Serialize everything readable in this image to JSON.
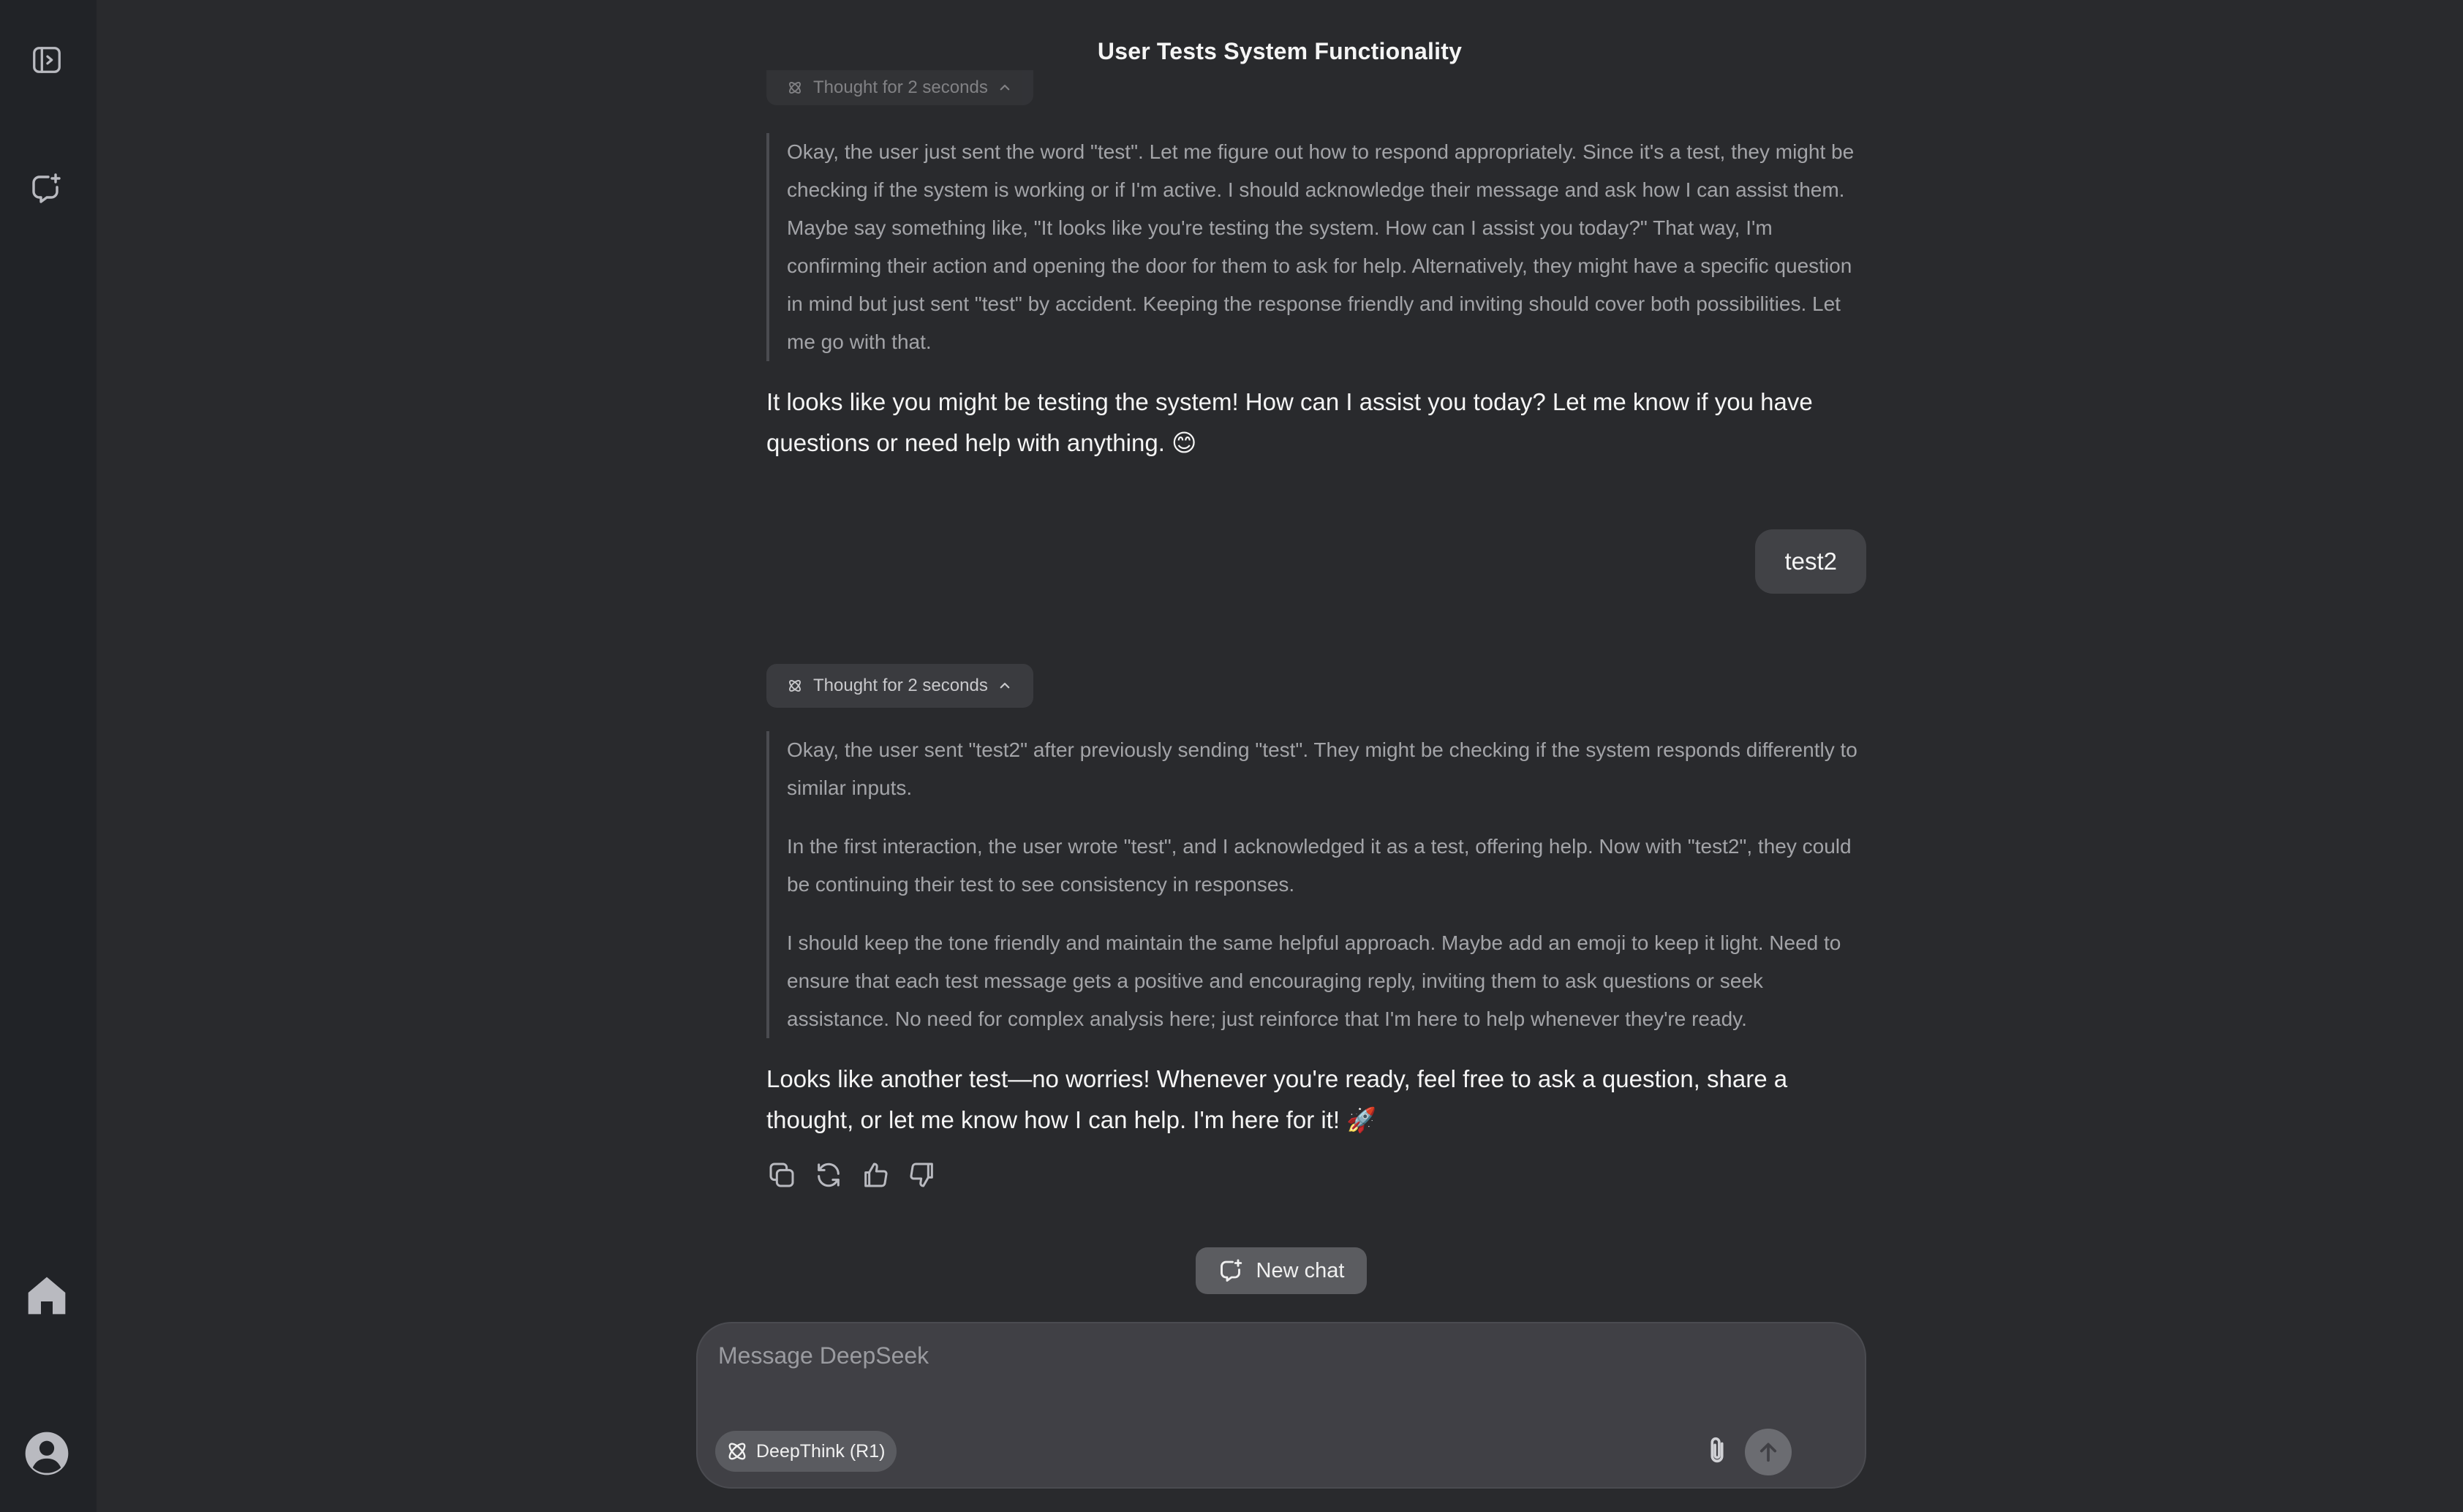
{
  "conversation": {
    "title": "User Tests System Functionality"
  },
  "messages": {
    "first_thought_label": "Thought for 2 seconds",
    "first_thinking": [
      "Okay, the user just sent the word \"test\". Let me figure out how to respond appropriately. Since it's a test, they might be checking if the system is working or if I'm active. I should acknowledge their message and ask how I can assist them. Maybe say something like, \"It looks like you're testing the system. How can I assist you today?\" That way, I'm confirming their action and opening the door for them to ask for help. Alternatively, they might have a specific question in mind but just sent \"test\" by accident. Keeping the response friendly and inviting should cover both possibilities. Let me go with that."
    ],
    "first_answer": "It looks like you might be testing the system! How can I assist you today? Let me know if you have questions or need help with anything. 😊",
    "user_message": "test2",
    "second_thought_label": "Thought for 2 seconds",
    "second_thinking": [
      "Okay, the user sent \"test2\" after previously sending \"test\". They might be checking if the system responds differently to similar inputs.",
      "In the first interaction, the user wrote \"test\", and I acknowledged it as a test, offering help. Now with \"test2\", they could be continuing their test to see consistency in responses.",
      "I should keep the tone friendly and maintain the same helpful approach. Maybe add an emoji to keep it light. Need to ensure that each test message gets a positive and encouraging reply, inviting them to ask questions or seek assistance. No need for complex analysis here; just reinforce that I'm here to help whenever they're ready."
    ],
    "second_answer": "Looks like another test—no worries! Whenever you're ready, feel free to ask a question, share a thought, or let me know how I can help. I'm here for it! 🚀"
  },
  "new_chat": {
    "label": "New chat"
  },
  "composer": {
    "value": "",
    "placeholder": "Message DeepSeek",
    "deepthink_label": "DeepThink (R1)"
  },
  "icons": {
    "sidebar_toggle": "sidebar-toggle-icon",
    "new_chat": "new-chat-icon",
    "home": "home-icon",
    "profile": "user-avatar-icon",
    "copy": "copy-icon",
    "regenerate": "refresh-icon",
    "like": "thumbs-up-icon",
    "dislike": "thumbs-down-icon",
    "attach": "paperclip-icon",
    "send": "arrow-up-icon",
    "deepthink": "atom-icon"
  },
  "colors": {
    "background": "#292a2d",
    "sidebar": "#212327",
    "user_bubble": "#414246",
    "composer": "#404045"
  }
}
